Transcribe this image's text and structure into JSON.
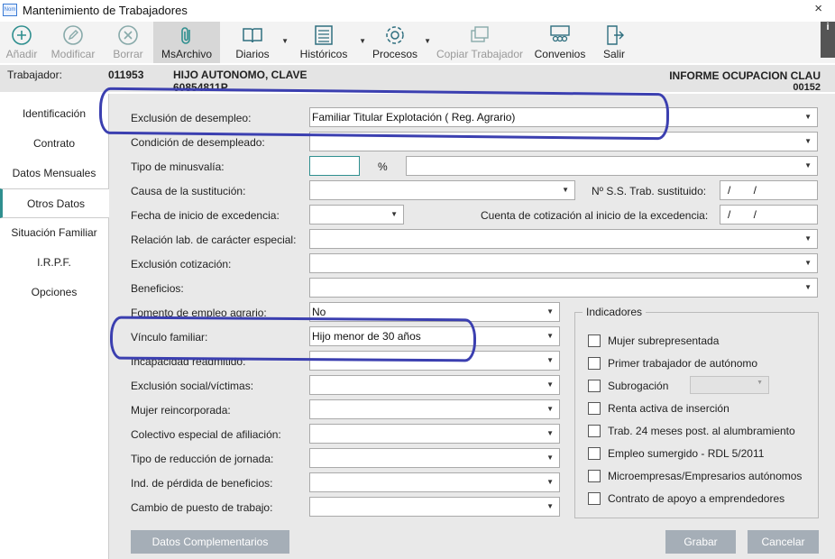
{
  "window": {
    "title": "Mantenimiento de Trabajadores",
    "icon_text": "Nom",
    "close": "×"
  },
  "toolbar": {
    "buttons": [
      {
        "label": "Añadir",
        "icon": "add-icon",
        "disabled": true
      },
      {
        "label": "Modificar",
        "icon": "edit-icon",
        "disabled": true
      },
      {
        "label": "Borrar",
        "icon": "delete-icon",
        "disabled": true
      },
      {
        "label": "MsArchivo",
        "icon": "paperclip-icon",
        "active": true
      },
      {
        "label": "Diarios",
        "icon": "book-icon",
        "dropdown": true
      },
      {
        "label": "Históricos",
        "icon": "history-list-icon",
        "dropdown": true
      },
      {
        "label": "Procesos",
        "icon": "gear-icon",
        "dropdown": true
      },
      {
        "label": "Copiar Trabajador",
        "icon": "copy-icon",
        "disabled": true
      },
      {
        "label": "Convenios",
        "icon": "people-icon"
      },
      {
        "label": "Salir",
        "icon": "exit-icon"
      }
    ],
    "info": "i"
  },
  "header": {
    "worker_label": "Trabajador:",
    "worker_code": "011953",
    "worker_name": "HIJO AUTONOMO, CLAVE",
    "worker_id": "60854811P",
    "report_title": "INFORME OCUPACION CLAU",
    "report_code": "00152"
  },
  "nav": {
    "items": [
      "Identificación",
      "Contrato",
      "Datos Mensuales",
      "Otros Datos",
      "Situación Familiar",
      "I.R.P.F.",
      "Opciones"
    ],
    "active": "Otros Datos"
  },
  "form": {
    "exclusion_desempleo": {
      "label": "Exclusión de desempleo:",
      "value": "Familiar Titular Explotación ( Reg. Agrario)"
    },
    "condicion_desempleado": {
      "label": "Condición de desempleado:",
      "value": ""
    },
    "tipo_minusvalia": {
      "label": "Tipo de minusvalía:",
      "value": "",
      "percent_sign": "%",
      "select_value": ""
    },
    "causa_sustitucion": {
      "label": "Causa de la sustitución:",
      "value": ""
    },
    "nss_sustituido": {
      "label": "Nº S.S. Trab. sustituido:",
      "value": "/ /"
    },
    "fecha_excedencia": {
      "label": "Fecha de inicio de excedencia:",
      "value": ""
    },
    "cuenta_cotizacion": {
      "label": "Cuenta de cotización al inicio de la excedencia:",
      "value": "/ /"
    },
    "relacion_lab": {
      "label": "Relación lab. de carácter especial:",
      "value": ""
    },
    "exclusion_cotizacion": {
      "label": "Exclusión cotización:",
      "value": ""
    },
    "beneficios": {
      "label": "Beneficios:",
      "value": ""
    },
    "fomento_empleo": {
      "label": "Fomento de empleo agrario:",
      "value": "No"
    },
    "vinculo_familiar": {
      "label": "Vínculo familiar:",
      "value": "Hijo menor de 30 años"
    },
    "incapacidad": {
      "label": "Incapacidad readmitido:",
      "value": ""
    },
    "exclusion_social": {
      "label": "Exclusión social/víctimas:",
      "value": ""
    },
    "mujer_reincorporada": {
      "label": "Mujer reincorporada:",
      "value": ""
    },
    "colectivo_especial": {
      "label": "Colectivo especial de afiliación:",
      "value": ""
    },
    "tipo_reduccion": {
      "label": "Tipo de reducción de jornada:",
      "value": ""
    },
    "ind_perdida": {
      "label": "Ind. de pérdida de beneficios:",
      "value": ""
    },
    "cambio_puesto": {
      "label": "Cambio de puesto de trabajo:",
      "value": ""
    }
  },
  "indicadores": {
    "title": "Indicadores",
    "items": [
      "Mujer subrepresentada",
      "Primer trabajador de autónomo",
      "Subrogación",
      "Renta activa de inserción",
      "Trab. 24 meses post. al alumbramiento",
      "Empleo sumergido - RDL 5/2011",
      "Microempresas/Empresarios autónomos",
      "Contrato de apoyo a emprendedores"
    ]
  },
  "buttons": {
    "datos_complementarios": "Datos Complementarios",
    "grabar": "Grabar",
    "cancelar": "Cancelar"
  },
  "colors": {
    "highlight": "#3b3fb0",
    "accent": "#2f8f8f",
    "button": "#a5aeb7"
  }
}
